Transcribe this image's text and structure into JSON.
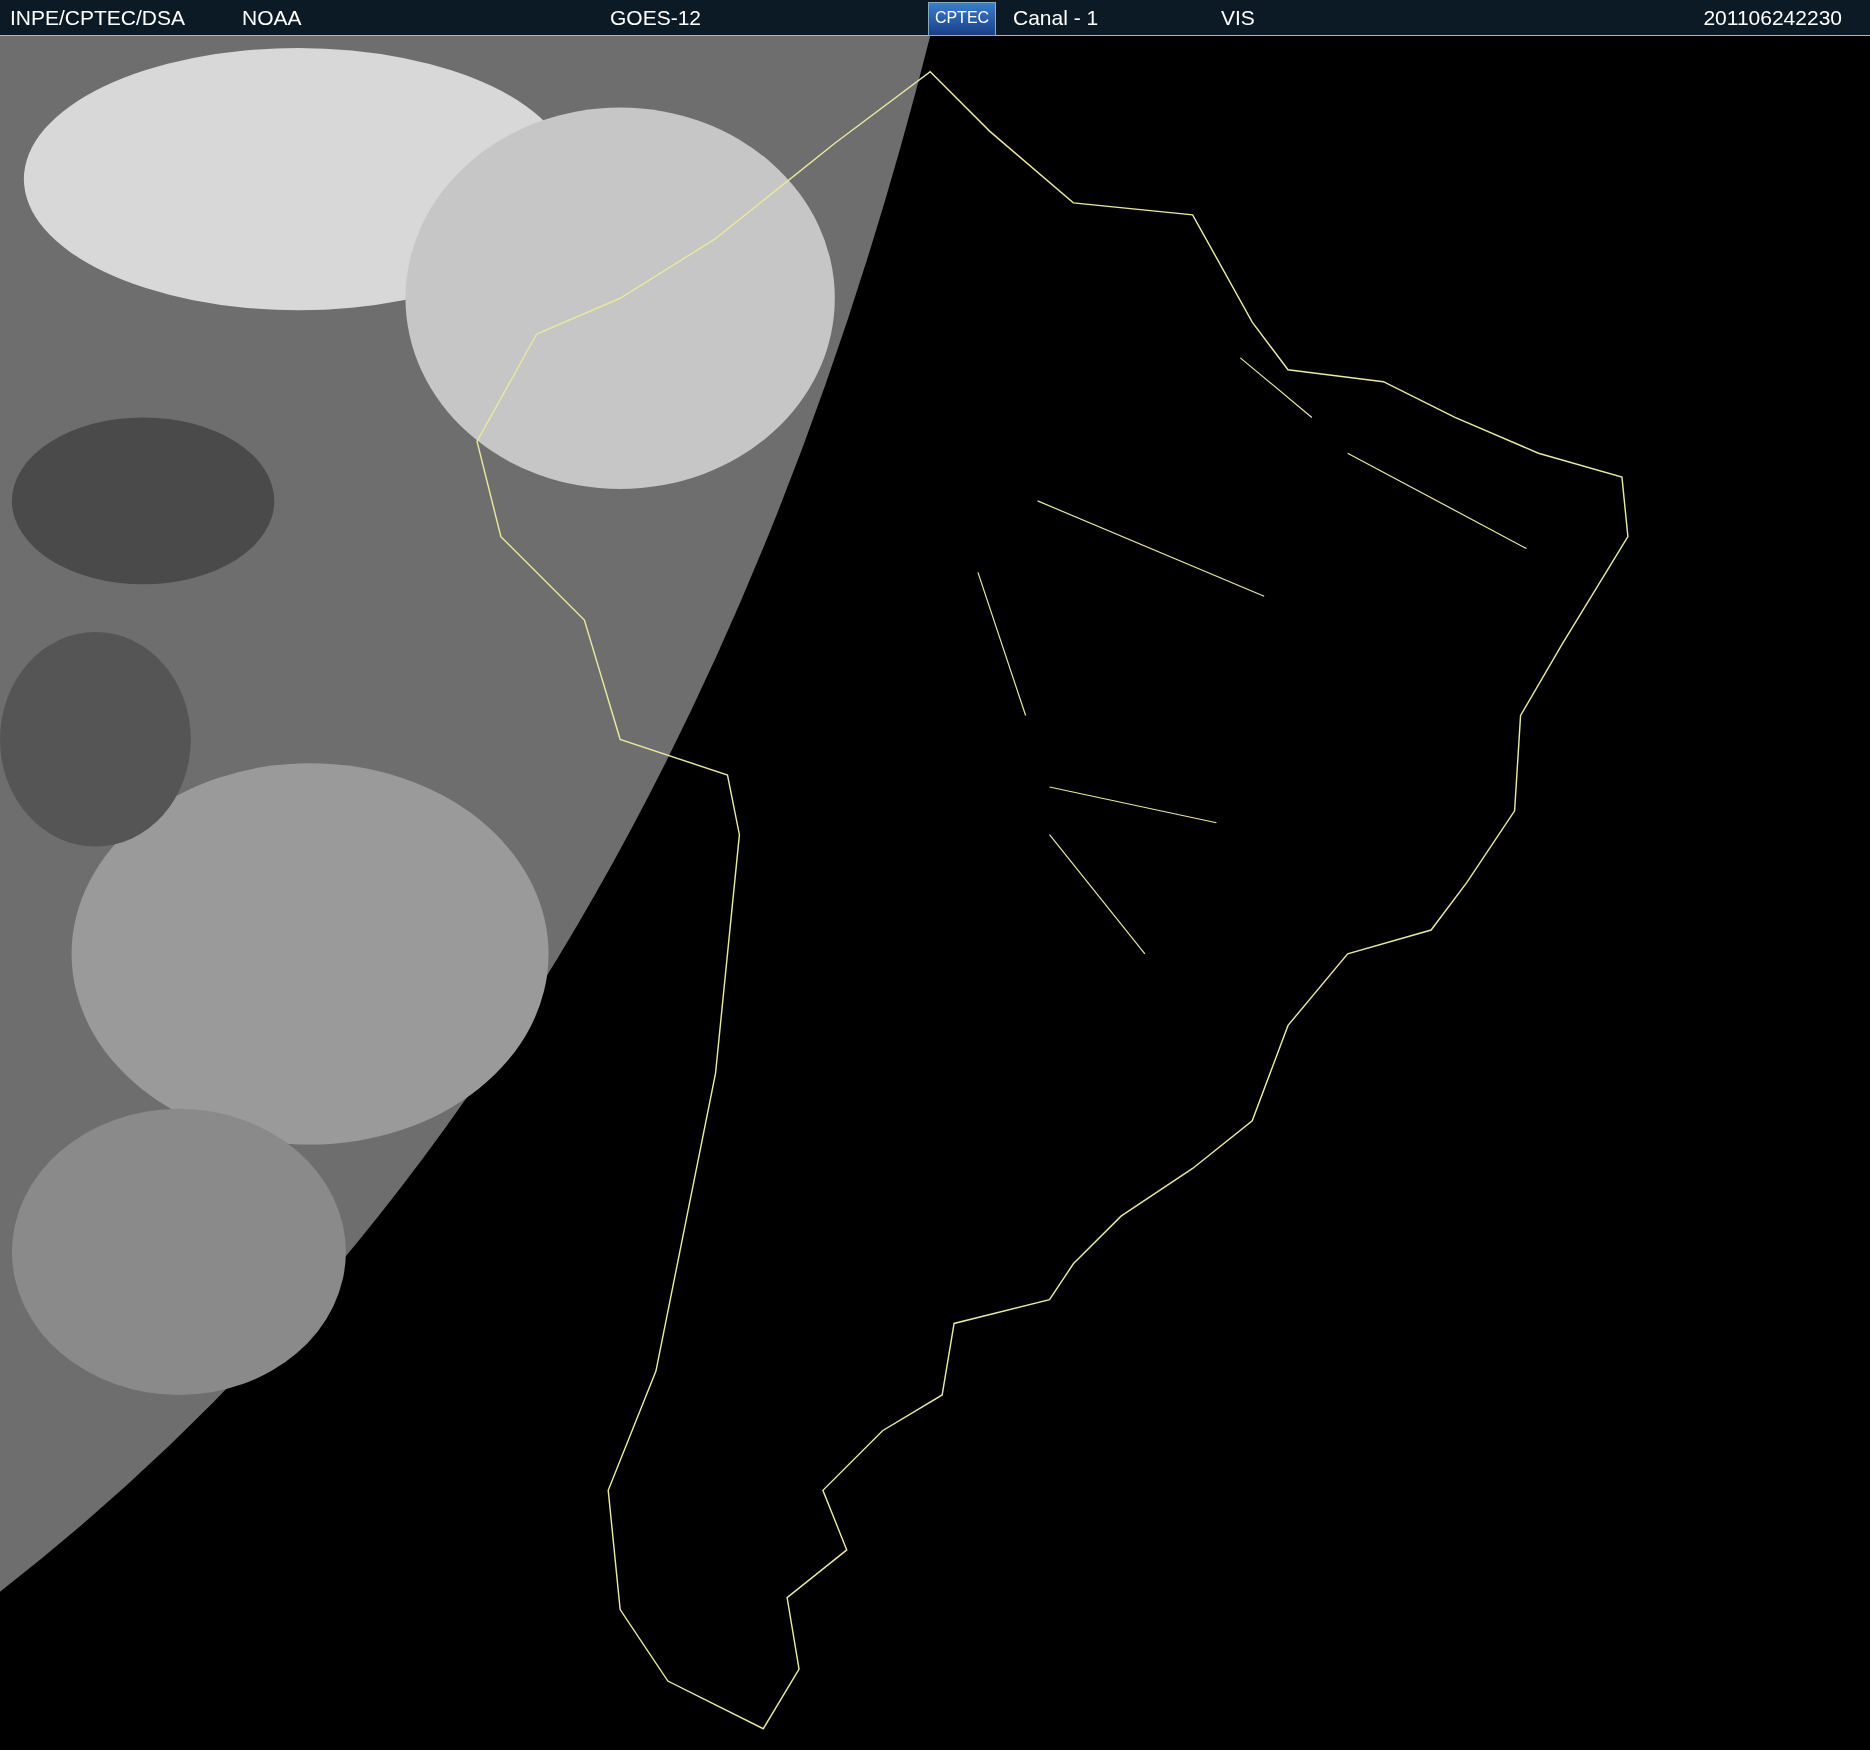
{
  "header": {
    "items": [
      {
        "kind": "text",
        "text": "INPE/CPTEC/DSA"
      },
      {
        "kind": "text",
        "text": "NOAA"
      },
      {
        "kind": "text",
        "text": "GOES-12"
      },
      {
        "kind": "logo",
        "text": "CPTEC"
      },
      {
        "kind": "text",
        "text": "Canal - 1"
      },
      {
        "kind": "text",
        "text": "VIS"
      },
      {
        "kind": "text",
        "text": "201106242230"
      }
    ]
  }
}
